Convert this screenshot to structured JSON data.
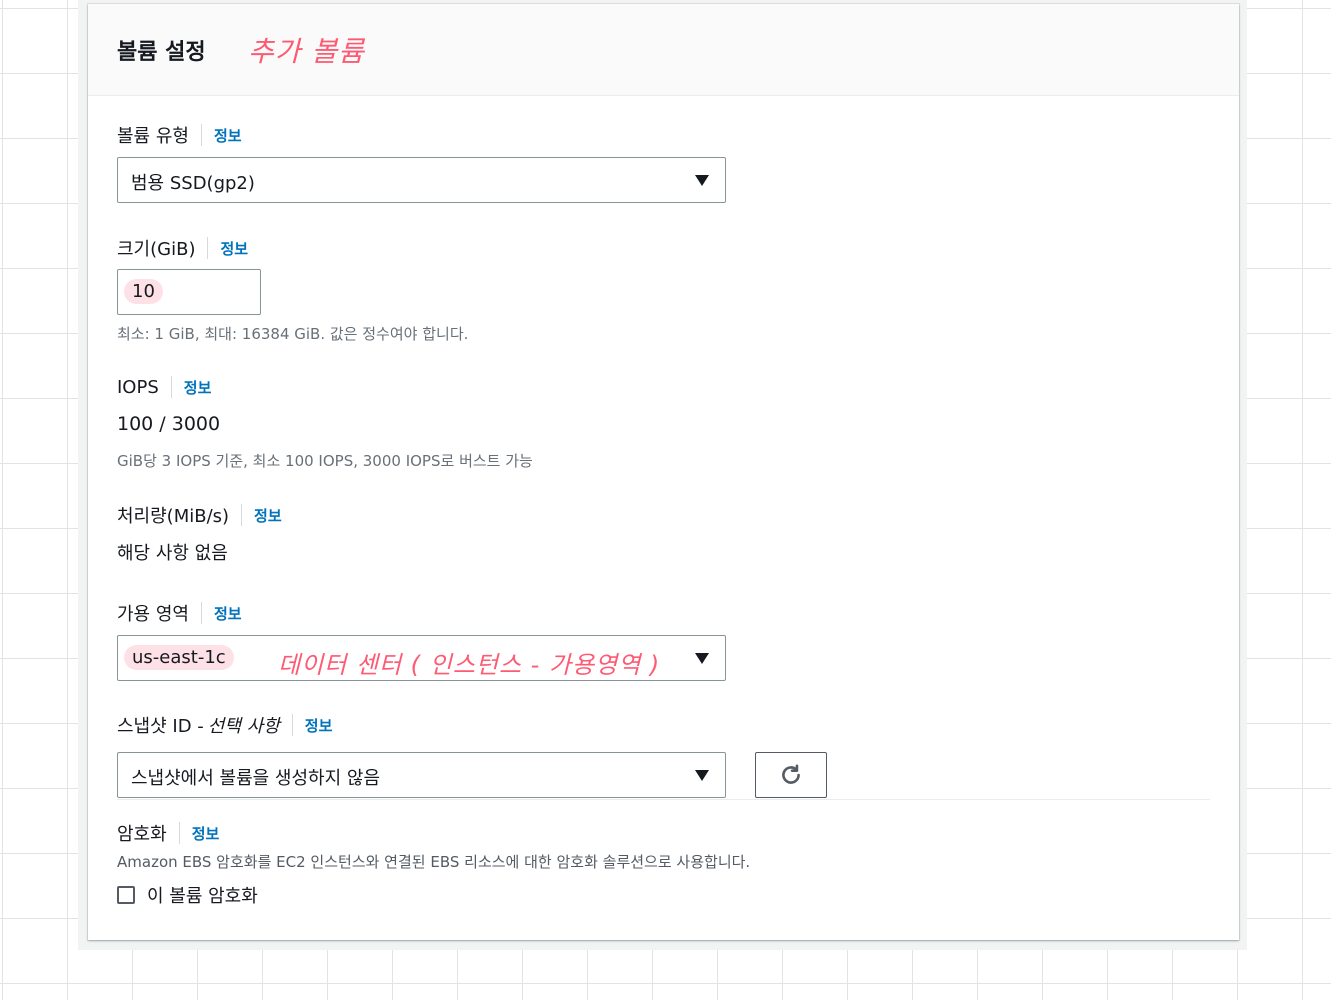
{
  "panel": {
    "title": "볼륨 설정",
    "annotation": "추가 볼륨"
  },
  "info_link": "정보",
  "volume_type": {
    "label": "볼륨 유형",
    "value": "범용 SSD(gp2)"
  },
  "size": {
    "label": "크기(GiB)",
    "value": "10",
    "hint": "최소: 1 GiB, 최대: 16384 GiB. 값은 정수여야 합니다."
  },
  "iops": {
    "label": "IOPS",
    "value": "100 / 3000",
    "hint": "GiB당 3 IOPS 기준, 최소 100 IOPS, 3000 IOPS로 버스트 가능"
  },
  "throughput": {
    "label": "처리량(MiB/s)",
    "value": "해당 사항 없음"
  },
  "availability_zone": {
    "label": "가용 영역",
    "value": "us-east-1c",
    "annotation": "데이터 센터 ( 인스턴스 - 가용영역 )"
  },
  "snapshot": {
    "label": "스냅샷 ID - ",
    "label_optional": "선택 사항",
    "value": "스냅샷에서 볼륨을 생성하지 않음"
  },
  "encryption": {
    "label": "암호화",
    "hint": "Amazon EBS 암호화를 EC2 인스턴스와 연결된 EBS 리소스에 대한 암호화 솔루션으로 사용합니다.",
    "checkbox_label": "이 볼륨 암호화"
  },
  "colors": {
    "info_link": "#0073bb",
    "annotation": "#ff5a73",
    "highlight": "#fde1e6"
  }
}
